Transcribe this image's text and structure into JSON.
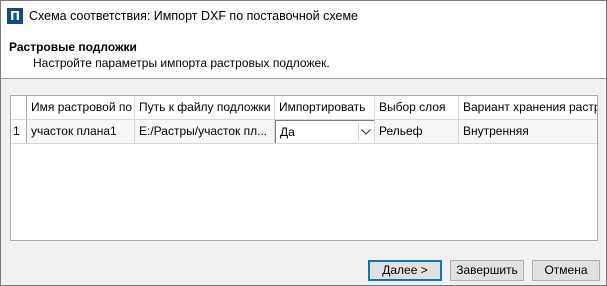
{
  "window": {
    "app_icon": "П",
    "title": "Схема соответствия: Импорт DXF по поставочной схеме"
  },
  "header": {
    "title": "Растровые подложки",
    "subtitle": "Настройте параметры импорта растровых подложек."
  },
  "grid": {
    "columns": [
      "Имя растровой по",
      "Путь к файлу подложки",
      "Импортировать",
      "Выбор слоя",
      "Вариант хранения растр"
    ],
    "rows": [
      {
        "num": "1",
        "name": "участок плана1",
        "path": "E:/Растры/участок пл...",
        "import": "Да",
        "layer": "Рельеф",
        "storage": "Внутренняя"
      }
    ]
  },
  "buttons": {
    "next": "Далее >",
    "finish": "Завершить",
    "cancel": "Отмена"
  }
}
